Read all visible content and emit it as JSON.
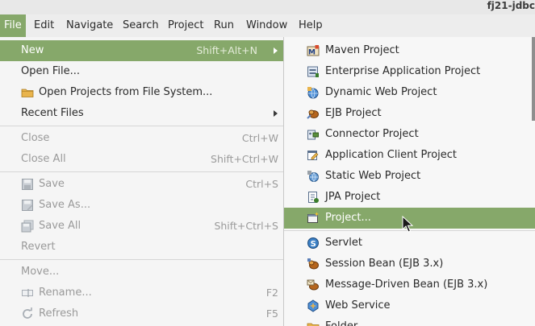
{
  "window": {
    "title": "fj21-jdbc"
  },
  "menubar": {
    "items": [
      {
        "label": "File",
        "active": true
      },
      {
        "label": "Edit"
      },
      {
        "label": "Navigate"
      },
      {
        "label": "Search"
      },
      {
        "label": "Project"
      },
      {
        "label": "Run"
      },
      {
        "label": "Window"
      },
      {
        "label": "Help"
      }
    ]
  },
  "file_menu": {
    "items": [
      {
        "label": "New",
        "shortcut": "Shift+Alt+N",
        "submenu": true,
        "highlighted": true
      },
      {
        "label": "Open File..."
      },
      {
        "label": "Open Projects from File System...",
        "icon": "folder-icon"
      },
      {
        "label": "Recent Files",
        "submenu": true
      },
      {
        "label": "Close",
        "shortcut": "Ctrl+W",
        "disabled": true
      },
      {
        "label": "Close All",
        "shortcut": "Shift+Ctrl+W",
        "disabled": true
      },
      {
        "label": "Save",
        "shortcut": "Ctrl+S",
        "disabled": true,
        "icon": "save-icon"
      },
      {
        "label": "Save As...",
        "disabled": true,
        "icon": "save-as-icon"
      },
      {
        "label": "Save All",
        "shortcut": "Shift+Ctrl+S",
        "disabled": true,
        "icon": "save-all-icon"
      },
      {
        "label": "Revert",
        "disabled": true
      },
      {
        "label": "Move...",
        "disabled": true
      },
      {
        "label": "Rename...",
        "shortcut": "F2",
        "disabled": true,
        "icon": "rename-icon"
      },
      {
        "label": "Refresh",
        "shortcut": "F5",
        "disabled": true,
        "icon": "refresh-icon"
      }
    ]
  },
  "new_submenu": {
    "items": [
      {
        "label": "Maven Project",
        "icon": "maven-project-icon"
      },
      {
        "label": "Enterprise Application Project",
        "icon": "enterprise-application-project-icon"
      },
      {
        "label": "Dynamic Web Project",
        "icon": "dynamic-web-project-icon"
      },
      {
        "label": "EJB Project",
        "icon": "ejb-project-icon"
      },
      {
        "label": "Connector Project",
        "icon": "connector-project-icon"
      },
      {
        "label": "Application Client Project",
        "icon": "application-client-project-icon"
      },
      {
        "label": "Static Web Project",
        "icon": "static-web-project-icon"
      },
      {
        "label": "JPA Project",
        "icon": "jpa-project-icon"
      },
      {
        "label": "Project...",
        "icon": "project-icon",
        "highlighted": true
      },
      {
        "label": "Servlet",
        "icon": "servlet-icon"
      },
      {
        "label": "Session Bean (EJB 3.x)",
        "icon": "session-bean-icon"
      },
      {
        "label": "Message-Driven Bean (EJB 3.x)",
        "icon": "message-driven-bean-icon"
      },
      {
        "label": "Web Service",
        "icon": "web-service-icon"
      },
      {
        "label": "Folder",
        "icon": "folder-icon"
      }
    ]
  },
  "colors": {
    "highlight": "#86a86a",
    "menu_background": "#f5f5f5",
    "disabled_text": "#9a9a9a"
  }
}
